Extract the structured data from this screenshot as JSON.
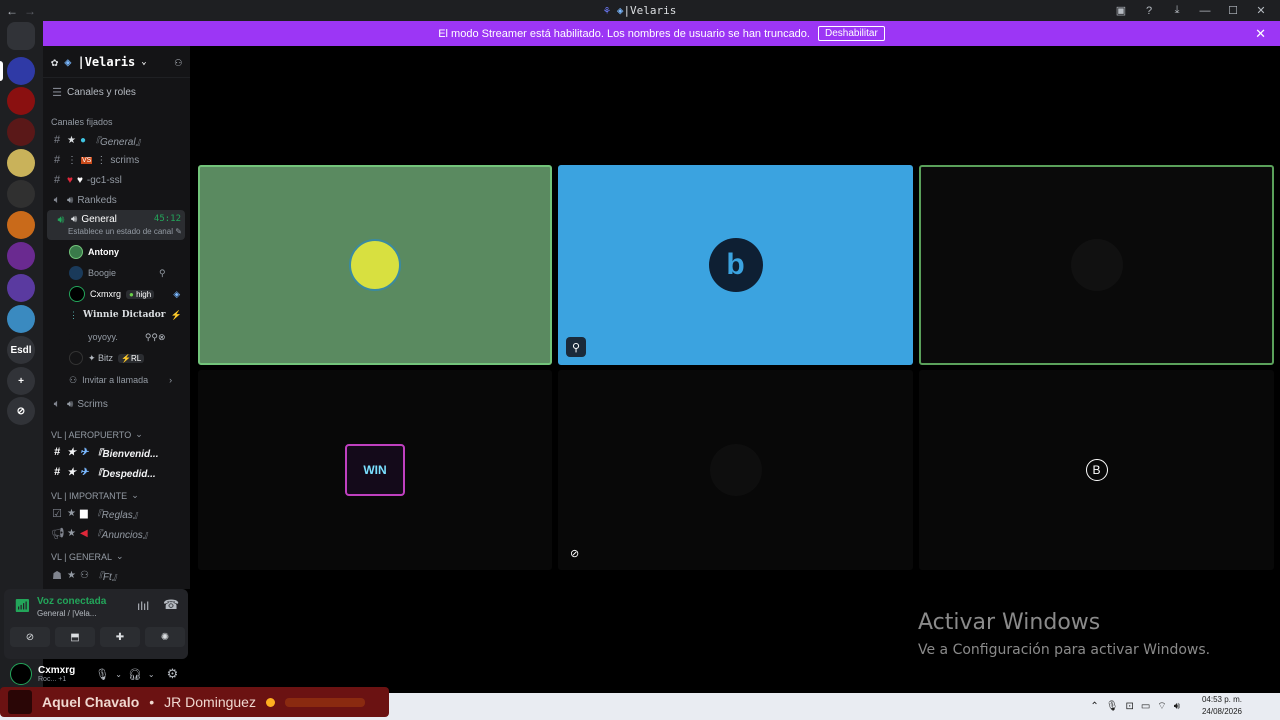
{
  "window": {
    "title": "|Velaris",
    "controls": [
      "inbox-icon",
      "help-icon",
      "download-icon",
      "minimize-icon",
      "maximize-icon",
      "close-icon"
    ]
  },
  "banner": {
    "message": "El modo Streamer está habilitado. Los nombres de usuario se han truncado.",
    "button": "Deshabilitar"
  },
  "rail": {
    "servers": [
      {
        "icon": "discord-icon",
        "color": "#313338",
        "label": ""
      },
      {
        "icon": "velaris-server",
        "color": "#2f3aa6",
        "label": ""
      },
      {
        "icon": "red-server",
        "color": "#8a1010",
        "label": ""
      },
      {
        "icon": "ry-server",
        "color": "#5a1818",
        "label": ""
      },
      {
        "icon": "yellow-server",
        "color": "#c9b25a",
        "label": ""
      },
      {
        "icon": "wolf-server",
        "color": "#303030",
        "label": ""
      },
      {
        "icon": "tiger-server",
        "color": "#c96a1a",
        "label": ""
      },
      {
        "icon": "purple-server",
        "color": "#6a2a90",
        "label": ""
      },
      {
        "icon": "game-server",
        "color": "#5a3aa0",
        "label": ""
      },
      {
        "icon": "landscape-server",
        "color": "#3a8ac0",
        "label": ""
      },
      {
        "icon": "text-server",
        "color": "#313338",
        "label": "Esdl"
      },
      {
        "icon": "add-server-icon",
        "color": "#313338",
        "label": "+"
      },
      {
        "icon": "explore-icon",
        "color": "#313338",
        "label": "⊘"
      }
    ]
  },
  "sidebar": {
    "server_name": "|Velaris",
    "roles_link": "Canales y roles",
    "pinned_header": "Canales fijados",
    "channels": [
      {
        "kind": "text",
        "label": "『General』",
        "prefix": "★·●"
      },
      {
        "kind": "text",
        "label": "scrims",
        "prefix": "VS"
      },
      {
        "kind": "text",
        "label": "-gc1-ssl",
        "prefix": "♥♡"
      },
      {
        "kind": "voice",
        "label": "Rankeds",
        "prefix": ""
      },
      {
        "kind": "voice",
        "label": "General",
        "prefix": "",
        "timer": "45:12"
      }
    ],
    "voice_status": "Establece un estado de canal",
    "members": [
      {
        "name": "Antony",
        "avatar": "#3a7a4a"
      },
      {
        "name": "Boogie",
        "avatar": "#3a8fd8"
      },
      {
        "name": "Cxmxrg",
        "avatar": "#000",
        "badge": "high"
      },
      {
        "name": "Winnie Dictador",
        "avatar": "#222"
      },
      {
        "name": "yoyoyy.",
        "avatar": "#141416"
      },
      {
        "name": "✦ Bitz",
        "avatar": "#141416",
        "badge": "RL"
      }
    ],
    "invite": "Invitar a llamada",
    "scrims": "Scrims",
    "categories": [
      {
        "name": "VL | AEROPUERTO",
        "channels": [
          "『Bienvenid...",
          "『Despedid..."
        ]
      },
      {
        "name": "VL | IMPORTANTE",
        "channels": [
          "『Reglas』",
          "『Anuncios』"
        ]
      },
      {
        "name": "VL | GENERAL",
        "channels": [
          "『Ft』"
        ]
      }
    ]
  },
  "voice_panel": {
    "title": "Voz conectada",
    "subtitle": "General / |Vela..."
  },
  "user_panel": {
    "name": "Cxmxrg",
    "subtitle": "Roc... +1"
  },
  "tiles": [
    {
      "name": "tile-antony",
      "bg": "#5a8a60",
      "border": "#72c47a"
    },
    {
      "name": "tile-boogie",
      "bg": "#3ba3e0",
      "border": "#3ba3e0"
    },
    {
      "name": "tile-cxmxrg",
      "bg": "#0a0a0a",
      "border": "#5aa05a"
    },
    {
      "name": "tile-winnie",
      "bg": "#080808",
      "border": "#080808"
    },
    {
      "name": "tile-yoyoyy",
      "bg": "#080808",
      "border": "#080808"
    },
    {
      "name": "tile-bitz",
      "bg": "#080808",
      "border": "#080808",
      "symbol": "B"
    }
  ],
  "watermark": {
    "title": "Activar Windows",
    "subtitle": "Ve a Configuración para activar Windows."
  },
  "overlay": {
    "artist": "Aquel Chavalo",
    "separator": "•",
    "track": "JR Dominguez"
  },
  "taskbar": {
    "time": "04:53 p. m.",
    "date": "24/08/2026"
  }
}
